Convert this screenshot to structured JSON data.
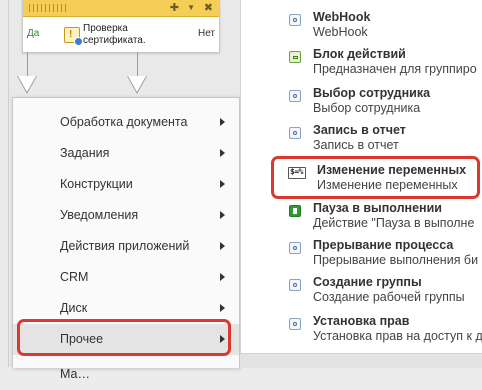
{
  "node": {
    "yes_label": "Да",
    "no_label": "Нет",
    "title": "Проверка сертификата.",
    "controls": [
      "✚",
      "▼",
      "✖"
    ],
    "icon": "certificate-check-icon"
  },
  "menu": {
    "items": [
      {
        "label": "Обработка документа",
        "has_submenu": true
      },
      {
        "label": "Задания",
        "has_submenu": true
      },
      {
        "label": "Конструкции",
        "has_submenu": true
      },
      {
        "label": "Уведомления",
        "has_submenu": true
      },
      {
        "label": "Действия приложений",
        "has_submenu": true
      },
      {
        "label": "CRM",
        "has_submenu": true
      },
      {
        "label": "Диск",
        "has_submenu": true
      },
      {
        "label": "Прочее",
        "has_submenu": true,
        "active": true
      },
      {
        "label": "Ма…",
        "has_submenu": true
      }
    ],
    "highlighted_item": "Прочее"
  },
  "actions": [
    {
      "title": "WebHook",
      "desc": "WebHook",
      "icon": "activity-icon"
    },
    {
      "title": "Блок действий",
      "desc": "Предназначен для группиро",
      "icon": "folder-icon"
    },
    {
      "title": "Выбор сотрудника",
      "desc": "Выбор сотрудника",
      "icon": "activity-icon"
    },
    {
      "title": "Запись в отчет",
      "desc": "Запись в отчет",
      "icon": "activity-icon"
    },
    {
      "title": "Изменение переменных",
      "desc": "Изменение переменных",
      "icon": "variable-icon",
      "icon_text": "$=%",
      "highlighted": true
    },
    {
      "title": "Пауза в выполнении",
      "desc": "Действие \"Пауза в выполне",
      "icon": "pause-icon"
    },
    {
      "title": "Прерывание процесса",
      "desc": "Прерывание выполнения би",
      "icon": "activity-icon"
    },
    {
      "title": "Создание группы",
      "desc": "Создание рабочей группы",
      "icon": "activity-icon"
    },
    {
      "title": "Установка прав",
      "desc": "Установка прав на доступ к д",
      "icon": "activity-icon"
    }
  ],
  "colors": {
    "highlight": "#d9392f",
    "node_header": "#f5ce55",
    "yes": "#2f8a2f"
  }
}
